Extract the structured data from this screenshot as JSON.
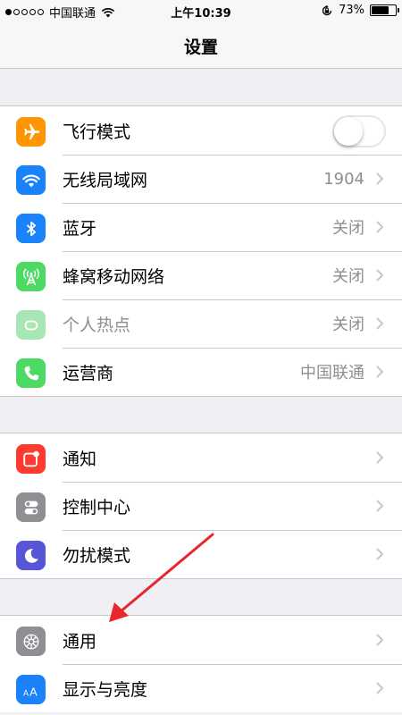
{
  "status_bar": {
    "carrier": "中国联通",
    "time": "上午10:39",
    "battery_percent": "73%",
    "battery_level": 0.73,
    "signal_bars_filled": 1,
    "signal_bars_total": 5
  },
  "nav": {
    "title": "设置"
  },
  "groups": [
    {
      "rows": [
        {
          "label": "飞行模式",
          "icon": "airplane-icon",
          "icon_color": "#ff9500",
          "control": "toggle",
          "toggle_on": false
        },
        {
          "label": "无线局域网",
          "icon": "wifi-icon",
          "icon_color": "#1a82fb",
          "value": "1904"
        },
        {
          "label": "蓝牙",
          "icon": "bluetooth-icon",
          "icon_color": "#1a82fb",
          "value": "关闭"
        },
        {
          "label": "蜂窝移动网络",
          "icon": "cellular-antenna-icon",
          "icon_color": "#4cd964",
          "value": "关闭"
        },
        {
          "label": "个人热点",
          "icon": "hotspot-icon",
          "icon_color": "#a8e6b5",
          "value": "关闭",
          "disabled": true
        },
        {
          "label": "运营商",
          "icon": "phone-icon",
          "icon_color": "#4cd964",
          "value": "中国联通"
        }
      ]
    },
    {
      "rows": [
        {
          "label": "通知",
          "icon": "notification-icon",
          "icon_color": "#ff3b30"
        },
        {
          "label": "控制中心",
          "icon": "control-center-icon",
          "icon_color": "#8e8e93"
        },
        {
          "label": "勿扰模式",
          "icon": "moon-icon",
          "icon_color": "#5856d6"
        }
      ]
    },
    {
      "rows": [
        {
          "label": "通用",
          "icon": "gear-icon",
          "icon_color": "#8e8e93"
        },
        {
          "label": "显示与亮度",
          "icon": "text-size-icon",
          "icon_color": "#1a82fb"
        }
      ]
    }
  ],
  "colors": {
    "background": "#efeff4",
    "separator": "#c8c7cc",
    "secondary_text": "#8e8e93",
    "annotation_arrow": "#e8262b"
  }
}
